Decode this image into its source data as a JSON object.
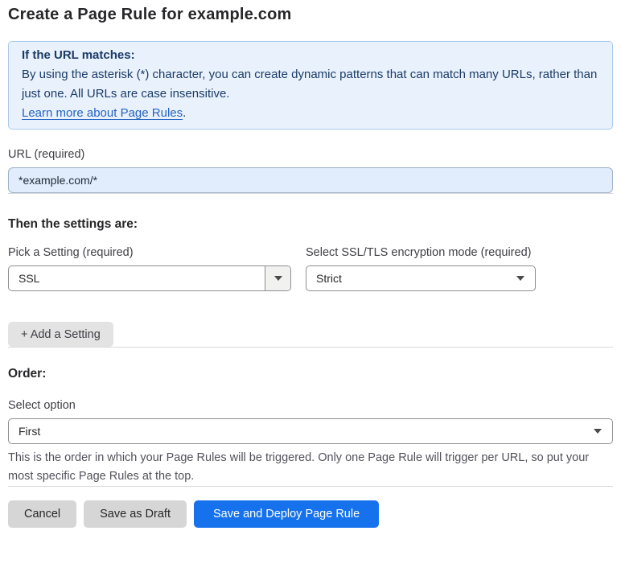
{
  "page": {
    "title": "Create a Page Rule for example.com"
  },
  "info_box": {
    "heading": "If the URL matches:",
    "body": "By using the asterisk (*) character, you can create dynamic patterns that can match many URLs, rather than just one. All URLs are case insensitive.",
    "link_label": "Learn more about Page Rules",
    "link_suffix": "."
  },
  "url_field": {
    "label": "URL (required)",
    "value": "*example.com/*"
  },
  "settings_section": {
    "heading": "Then the settings are:",
    "setting_picker": {
      "label": "Pick a Setting (required)",
      "value": "SSL"
    },
    "mode_picker": {
      "label": "Select SSL/TLS encryption mode (required)",
      "value": "Strict"
    },
    "add_setting_label": "+ Add a Setting"
  },
  "order_section": {
    "heading": "Order:",
    "select_label": "Select option",
    "value": "First",
    "help_text": "This is the order in which your Page Rules will be triggered. Only one Page Rule will trigger per URL, so put your most specific Page Rules at the top."
  },
  "footer": {
    "cancel_label": "Cancel",
    "save_draft_label": "Save as Draft",
    "save_deploy_label": "Save and Deploy Page Rule"
  },
  "colors": {
    "accent_blue": "#1672ec",
    "info_bg": "#e9f2fc",
    "info_border": "#a9c9ec",
    "info_text": "#1b3a66",
    "link_blue": "#2563c2",
    "input_bg": "#e1ecfc",
    "gray_button": "#d6d6d6"
  }
}
